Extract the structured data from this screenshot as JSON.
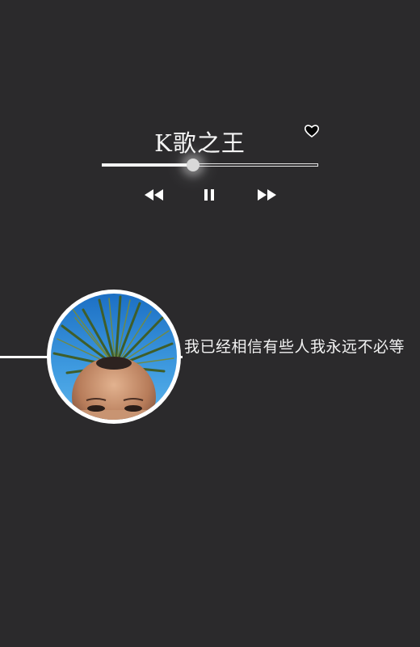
{
  "player": {
    "song_title": "K歌之王",
    "progress": 0.42
  },
  "lyrics": {
    "current_line": "我已经相信有些人我永远不必等"
  },
  "icons": {
    "favorite": "heart-icon",
    "previous": "rewind-icon",
    "play_state": "pause-icon",
    "next": "fast-forward-icon"
  },
  "colors": {
    "background": "#2b2a2c",
    "foreground": "#ffffff"
  }
}
